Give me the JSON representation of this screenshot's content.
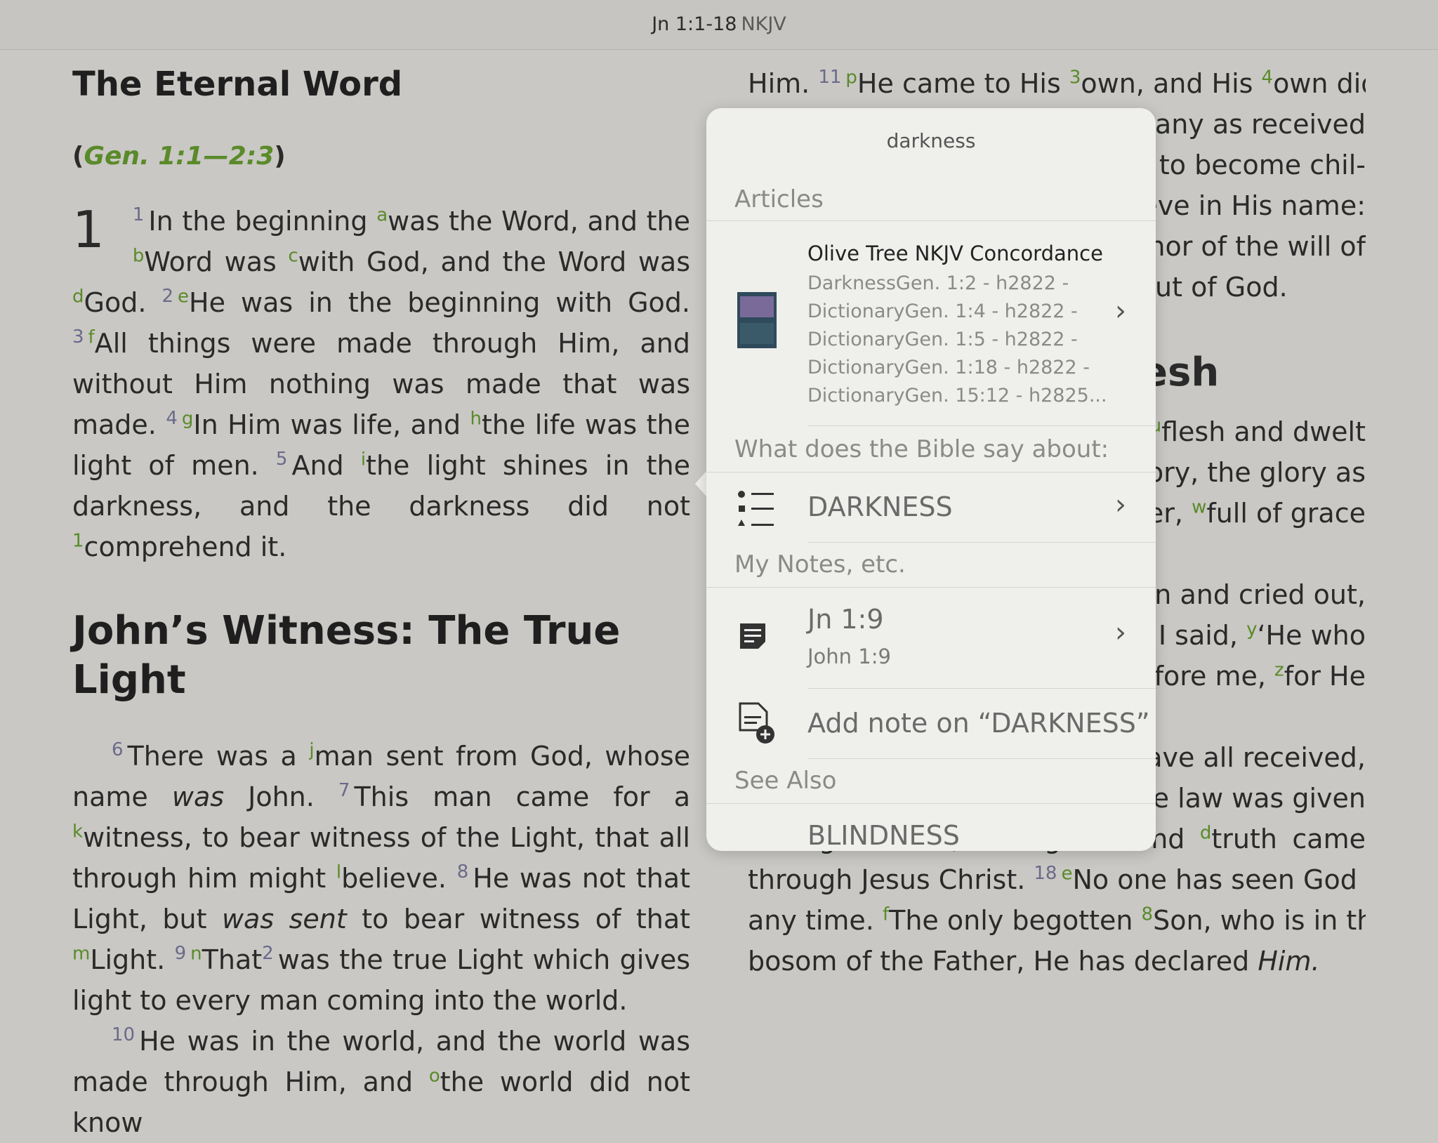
{
  "header": {
    "ref": "Jn 1:1-18",
    "version": "NKJV"
  },
  "left": {
    "heading1": "The Eternal Word",
    "crossref_open": "(",
    "crossref": "Gen. 1:1—2:3",
    "crossref_close": ")",
    "chapter": "1",
    "heading2": "John’s Witness: The True Light"
  },
  "right": {
    "partial_heading": "esh"
  },
  "popup": {
    "title": "darkness",
    "articles_label": "Articles",
    "concordance": {
      "title": "Olive Tree NKJV Concordance",
      "lines": [
        "DarknessGen. 1:2 - h2822 -",
        "DictionaryGen. 1:4 - h2822 -",
        "DictionaryGen. 1:5 - h2822 -",
        "DictionaryGen. 1:18 - h2822 -",
        "DictionaryGen. 15:12 - h2825..."
      ]
    },
    "bible_says_label": "What does the Bible say about:",
    "topic": "DARKNESS",
    "notes_label": "My Notes, etc.",
    "note_ref": "Jn 1:9",
    "note_sub": "John 1:9",
    "add_note": "Add note on “DARKNESS”",
    "see_also_label": "See Also",
    "see_also_item": "BLINDNESS"
  }
}
